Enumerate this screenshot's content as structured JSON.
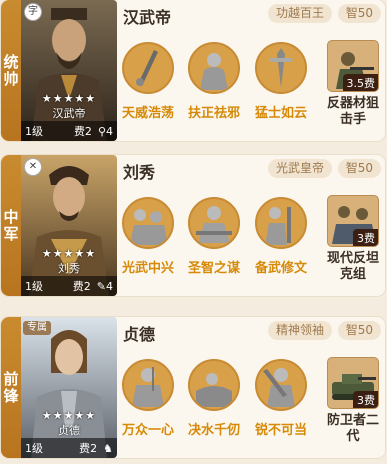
{
  "cards": [
    {
      "role": "统帅",
      "corner_badge": "字",
      "special_tag": "",
      "name": "汉武帝",
      "portrait_name": "汉武帝",
      "stars": "★★★★★",
      "level": "1级",
      "cost_label": "费2",
      "cost_extra": "4",
      "title_tag": "功越百王",
      "int_tag": "智50",
      "skills": [
        "天威浩荡",
        "扶正祛邪",
        "猛士如云"
      ],
      "combo": {
        "cost": "3.5费",
        "name": "反器材狙击手"
      }
    },
    {
      "role": "中军",
      "corner_badge": "✕",
      "special_tag": "",
      "name": "刘秀",
      "portrait_name": "刘秀",
      "stars": "★★★★★",
      "level": "1级",
      "cost_label": "费2",
      "cost_extra": "4",
      "title_tag": "光武皇帝",
      "int_tag": "智50",
      "skills": [
        "光武中兴",
        "圣智之谋",
        "备武修文"
      ],
      "combo": {
        "cost": "3费",
        "name": "现代反坦克组"
      }
    },
    {
      "role": "前锋",
      "corner_badge": "",
      "special_tag": "专属",
      "name": "贞德",
      "portrait_name": "贞德",
      "stars": "★★★★★",
      "level": "1级",
      "cost_label": "费2",
      "cost_extra": "",
      "title_tag": "精神领袖",
      "int_tag": "智50",
      "skills": [
        "万众一心",
        "决水千仞",
        "锐不可当"
      ],
      "combo": {
        "cost": "3费",
        "name": "防卫者二代"
      }
    }
  ]
}
